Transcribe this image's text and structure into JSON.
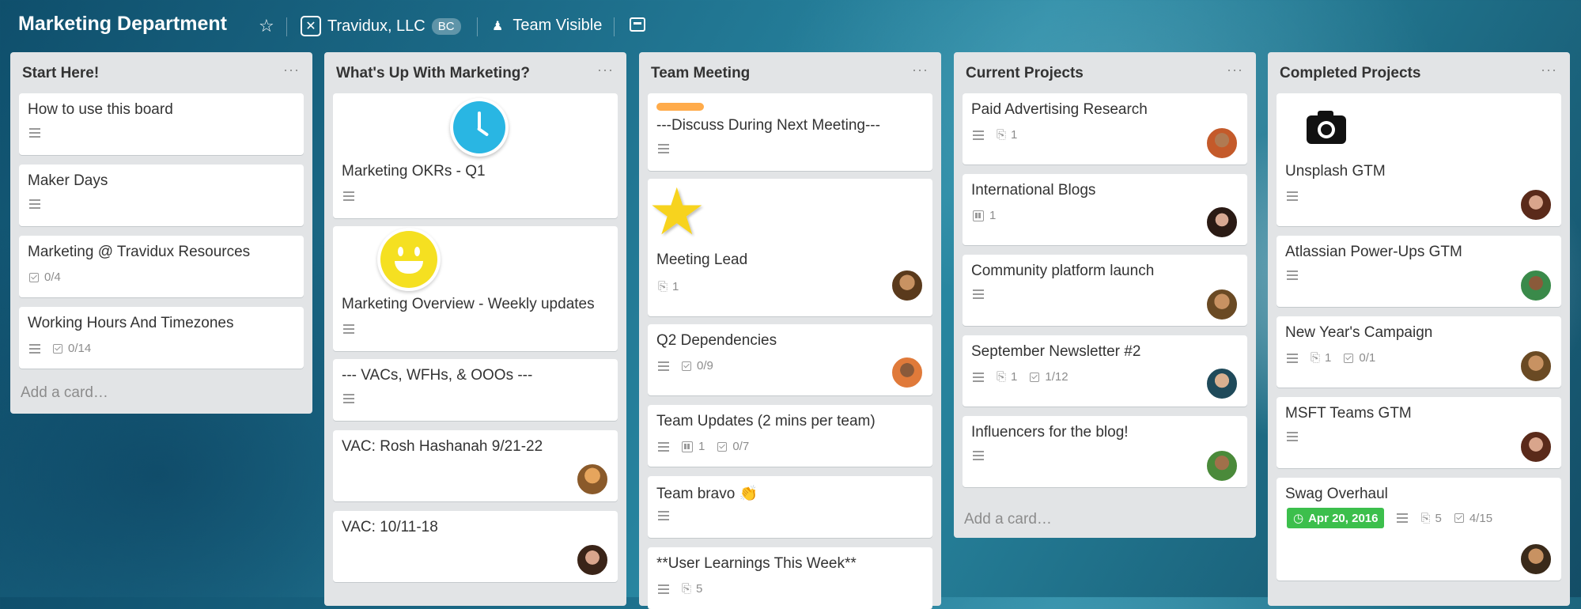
{
  "header": {
    "title": "Marketing Department",
    "org_name": "Travidux, LLC",
    "org_badge": "BC",
    "visibility": "Team Visible"
  },
  "lists": [
    {
      "title": "Start Here!",
      "cards": [
        {
          "title": "How to use this board"
        },
        {
          "title": "Maker Days"
        },
        {
          "title": "Marketing @ Travidux Resources",
          "checklist": "0/4"
        },
        {
          "title": "Working Hours And Timezones",
          "checklist": "0/14"
        }
      ],
      "add_card": "Add a card…"
    },
    {
      "title": "What's Up With Marketing?",
      "cards": [
        {
          "title": "Marketing OKRs - Q1"
        },
        {
          "title": "Marketing Overview - Weekly updates"
        },
        {
          "title": "--- VACs, WFHs, & OOOs ---"
        },
        {
          "title": "VAC: Rosh Hashanah 9/21-22"
        },
        {
          "title": "VAC: 10/11-18"
        }
      ]
    },
    {
      "title": "Team Meeting",
      "cards": [
        {
          "title": "---Discuss During Next Meeting---"
        },
        {
          "title": "Meeting Lead",
          "attachments": "1"
        },
        {
          "title": "Q2 Dependencies",
          "checklist": "0/9"
        },
        {
          "title": "Team Updates (2 mins per team)",
          "boards": "1",
          "checklist": "0/7"
        },
        {
          "title": "Team bravo 👏"
        },
        {
          "title": "**User Learnings This Week**",
          "attachments": "5"
        }
      ]
    },
    {
      "title": "Current Projects",
      "cards": [
        {
          "title": "Paid Advertising Research",
          "attachments": "1"
        },
        {
          "title": "International Blogs",
          "boards": "1"
        },
        {
          "title": "Community platform launch"
        },
        {
          "title": "September Newsletter #2",
          "attachments": "1",
          "checklist": "1/12"
        },
        {
          "title": "Influencers for the blog!"
        }
      ],
      "add_card": "Add a card…"
    },
    {
      "title": "Completed Projects",
      "cards": [
        {
          "title": "Unsplash GTM"
        },
        {
          "title": "Atlassian Power-Ups GTM"
        },
        {
          "title": "New Year's Campaign",
          "attachments": "1",
          "checklist": "0/1"
        },
        {
          "title": "MSFT Teams GTM"
        },
        {
          "title": "Swag Overhaul",
          "due": "Apr 20, 2016",
          "attachments": "5",
          "checklist": "4/15"
        }
      ]
    }
  ],
  "colors": {
    "label_orange": "#ffab4a",
    "due_green": "#3cbf4c",
    "list_bg": "#e2e4e6"
  }
}
